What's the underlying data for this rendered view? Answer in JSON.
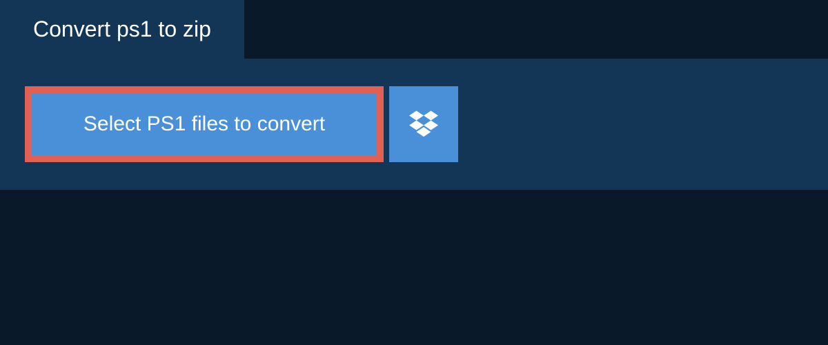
{
  "header": {
    "title": "Convert ps1 to zip"
  },
  "actions": {
    "select_label": "Select PS1 files to convert"
  },
  "icons": {
    "dropbox": "dropbox-icon"
  },
  "colors": {
    "background": "#0a1929",
    "panel": "#133656",
    "button": "#4a90d9",
    "highlight_border": "#e06055"
  }
}
